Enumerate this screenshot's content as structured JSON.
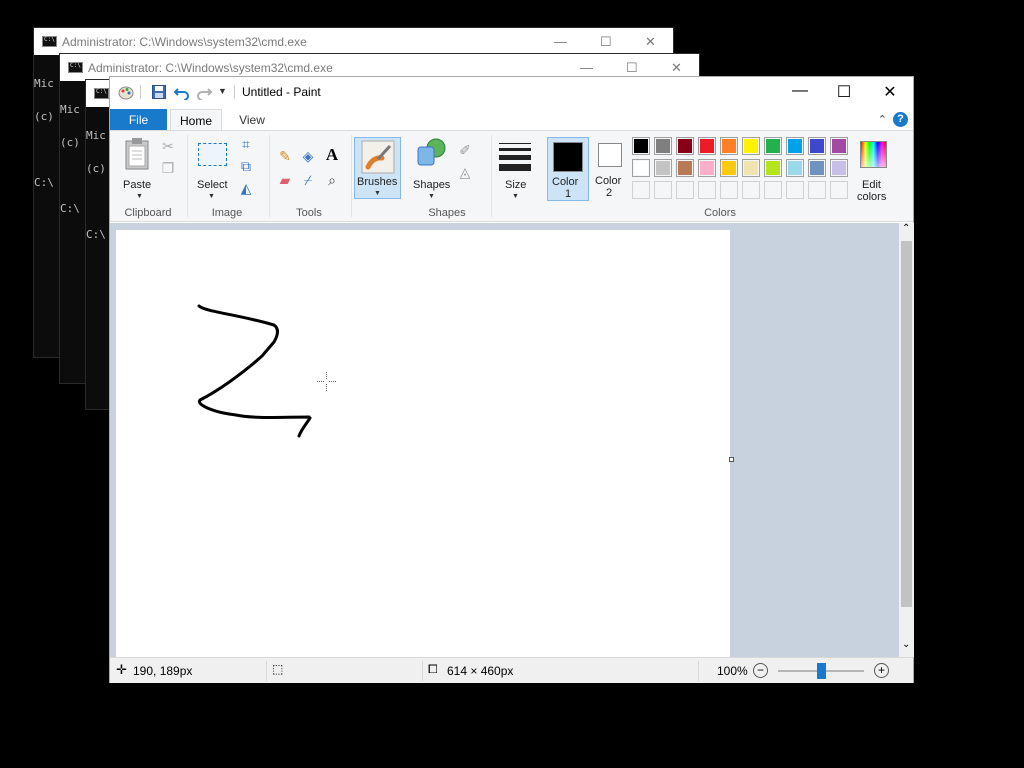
{
  "cmd_windows": [
    {
      "title": "Administrator: C:\\Windows\\system32\\cmd.exe",
      "lines": [
        "Mic",
        "(c)",
        "",
        "C:\\"
      ]
    },
    {
      "title": "Administrator: C:\\Windows\\system32\\cmd.exe",
      "lines": [
        "Mic",
        "(c)",
        "",
        "C:\\"
      ]
    },
    {
      "title": "",
      "lines": [
        "Mic",
        "(c)",
        "",
        "C:\\"
      ]
    }
  ],
  "paint": {
    "title": "Untitled - Paint",
    "controls": {
      "minimize": "—",
      "maximize": "☐",
      "close": "✕"
    },
    "tabs": {
      "file": "File",
      "home": "Home",
      "view": "View"
    },
    "help": "?",
    "collapse": "⌃",
    "groups": {
      "clipboard": "Clipboard",
      "image": "Image",
      "tools": "Tools",
      "shapes": "Shapes",
      "colors": "Colors"
    },
    "buttons": {
      "paste": "Paste",
      "select": "Select",
      "brushes": "Brushes",
      "shapes": "Shapes",
      "size": "Size",
      "color1_line1": "Color",
      "color1_line2": "1",
      "color2_line1": "Color",
      "color2_line2": "2",
      "edit_colors_line1": "Edit",
      "edit_colors_line2": "colors"
    },
    "palette_row1": [
      "#000000",
      "#7f7f7f",
      "#880015",
      "#ed1c24",
      "#ff7f27",
      "#fff200",
      "#22b14c",
      "#00a2e8",
      "#3f48cc",
      "#a349a4"
    ],
    "palette_row2": [
      "#ffffff",
      "#c3c3c3",
      "#b97a57",
      "#ffaec9",
      "#ffc90e",
      "#efe4b0",
      "#b5e61d",
      "#99d9ea",
      "#7092be",
      "#c8bfe7"
    ],
    "color1": "#000000",
    "color2": "#ffffff",
    "accent": "#1979ca",
    "status": {
      "cursor_pos": "190, 189px",
      "image_size": "614 × 460px",
      "zoom": "100%",
      "zoom_level": 1.0
    }
  }
}
